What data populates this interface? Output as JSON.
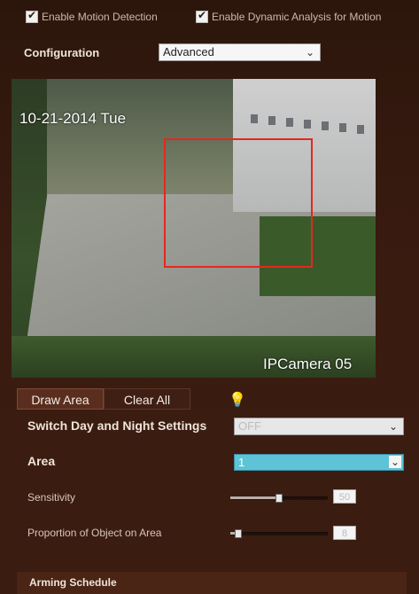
{
  "top": {
    "enable_motion": {
      "label": "Enable Motion Detection",
      "checked": true
    },
    "enable_dynamic": {
      "label": "Enable Dynamic Analysis for Motion",
      "checked": true
    }
  },
  "configuration": {
    "label": "Configuration",
    "value": "Advanced"
  },
  "video": {
    "date": "10-21-2014 Tue",
    "camera": "IPCamera 05"
  },
  "tools": {
    "draw_area": "Draw Area",
    "clear_all": "Clear All"
  },
  "day_night": {
    "label": "Switch Day and Night Settings",
    "value": "OFF"
  },
  "area": {
    "label": "Area",
    "value": "1"
  },
  "sensitivity": {
    "label": "Sensitivity",
    "value": "50",
    "level": 0.5
  },
  "proportion": {
    "label": "Proportion of Object on Area",
    "value": "8",
    "level": 0.08
  },
  "footer": {
    "label": "Arming Schedule"
  },
  "colors": {
    "accent": "#5fc3d8",
    "roi": "#e5281e"
  }
}
